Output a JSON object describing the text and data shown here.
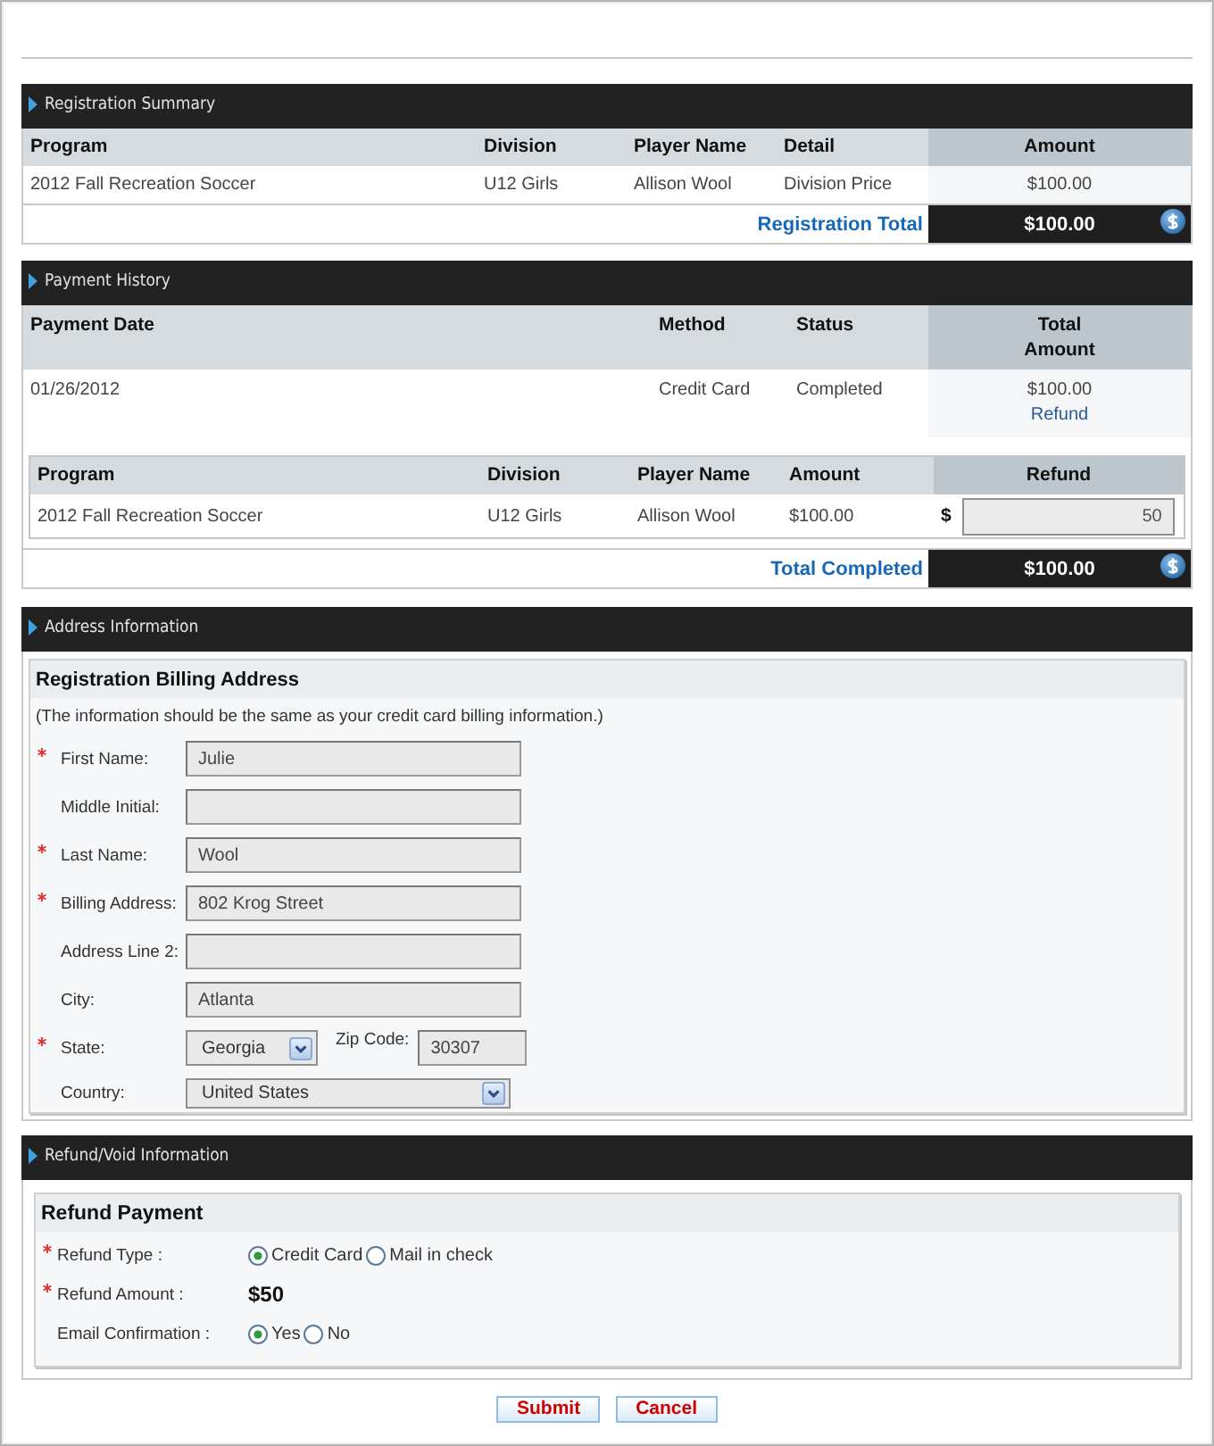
{
  "registration_summary": {
    "title": "Registration Summary",
    "columns": [
      "Program",
      "Division",
      "Player Name",
      "Detail",
      "Amount"
    ],
    "rows": [
      [
        "2012 Fall Recreation Soccer",
        "U12 Girls",
        "Allison Wool",
        "Division Price",
        "$100.00"
      ]
    ],
    "total": {
      "label": "Registration Total",
      "amount": "$100.00"
    }
  },
  "payment_history": {
    "title": "Payment History",
    "columns": [
      "Payment Date",
      "Method",
      "Status",
      "Total Amount"
    ],
    "payments": [
      {
        "date": "01/26/2012",
        "method": "Credit Card",
        "status": "Completed",
        "amount": "$100.00",
        "action": "Refund"
      }
    ],
    "refund_table": {
      "columns": [
        "Program",
        "Division",
        "Player Name",
        "Amount",
        "Refund"
      ],
      "rows": [
        {
          "program": "2012 Fall Recreation Soccer",
          "division": "U12 Girls",
          "player_name": "Allison Wool",
          "amount": "$100.00",
          "currency": "$",
          "refund": "50"
        }
      ]
    },
    "total": {
      "label": "Total Completed",
      "amount": "$100.00"
    }
  },
  "address_information": {
    "title": "Address Information",
    "box_title": "Registration Billing Address",
    "note": "(The information should be the same as your credit card billing information.)",
    "fields": [
      {
        "kind": "text",
        "label": "First Name:",
        "required": true,
        "value": "Julie"
      },
      {
        "kind": "text",
        "label": "Middle Initial:",
        "required": false
      },
      {
        "kind": "text",
        "label": "Last Name:",
        "required": true,
        "value": "Wool"
      },
      {
        "kind": "text",
        "label": "Billing Address:",
        "required": true,
        "value": "802 Krog Street"
      },
      {
        "kind": "text",
        "label": "Address Line 2:",
        "required": false
      },
      {
        "kind": "text",
        "label": "City:",
        "required": false,
        "value": "Atlanta"
      },
      {
        "kind": "select",
        "label": "State:",
        "required": true,
        "value": "Georgia",
        "zip": {
          "label": "Zip Code:",
          "value": "30307"
        }
      },
      {
        "kind": "select",
        "label": "Country:",
        "required": false,
        "value": "United States"
      }
    ]
  },
  "refund_void_information": {
    "title": "Refund/Void Information",
    "box_title": "Refund Payment",
    "rows": [
      {
        "kind": "radio",
        "label": "Refund Type :",
        "required": true,
        "options": [
          {
            "label": "Credit Card",
            "selected": true
          },
          {
            "label": "Mail in check",
            "selected": false
          }
        ]
      },
      {
        "kind": "amount",
        "label": "Refund Amount :",
        "required": true,
        "value": "$50"
      },
      {
        "kind": "radio",
        "label": "Email Confirmation :",
        "required": false,
        "options": [
          {
            "label": "Yes",
            "selected": true
          },
          {
            "label": "No",
            "selected": false
          }
        ]
      }
    ]
  },
  "buttons": [
    {
      "label": "Submit"
    },
    {
      "label": "Cancel"
    }
  ]
}
